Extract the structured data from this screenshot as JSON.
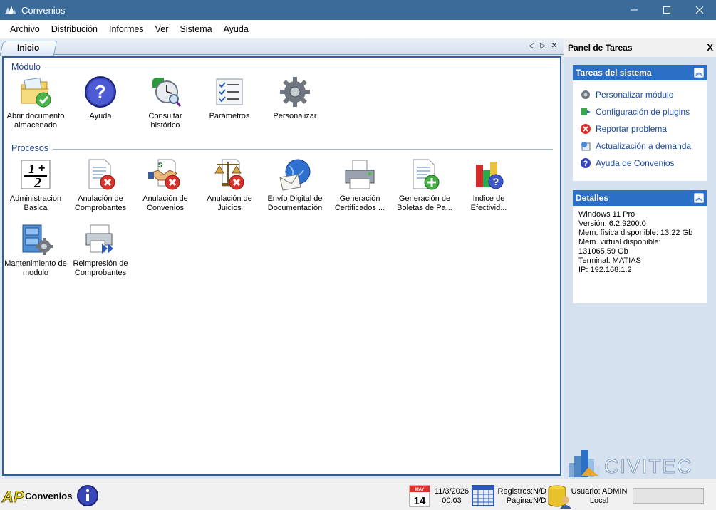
{
  "window": {
    "title": "Convenios"
  },
  "menu": [
    "Archivo",
    "Distribución",
    "Informes",
    "Ver",
    "Sistema",
    "Ayuda"
  ],
  "tab": {
    "label": "Inicio"
  },
  "sections": {
    "modulo": {
      "title": "Módulo",
      "tiles": [
        {
          "label": "Abrir documento\nalmacenado",
          "icon": "folder-check-icon"
        },
        {
          "label": "Ayuda",
          "icon": "help-icon"
        },
        {
          "label": "Consultar\nhistórico",
          "icon": "history-clock-icon"
        },
        {
          "label": "Parámetros",
          "icon": "checklist-icon"
        },
        {
          "label": "Personalizar",
          "icon": "gear-icon"
        }
      ]
    },
    "procesos": {
      "title": "Procesos",
      "tiles": [
        {
          "label": "Administracion\nBasica",
          "icon": "numbers-icon"
        },
        {
          "label": "Anulación de\nComprobantes",
          "icon": "document-cancel-icon"
        },
        {
          "label": "Anulación de\nConvenios",
          "icon": "handshake-cancel-icon"
        },
        {
          "label": "Anulación de\nJuicios",
          "icon": "scales-cancel-icon"
        },
        {
          "label": "Envío Digital de\nDocumentación",
          "icon": "globe-mail-icon"
        },
        {
          "label": "Generación\nCertificados ...",
          "icon": "printer-icon"
        },
        {
          "label": "Generación de\nBoletas de Pa...",
          "icon": "document-add-icon"
        },
        {
          "label": "Indice de\nEfectivid...",
          "icon": "chart-help-icon"
        },
        {
          "label": "Mantenimiento de\nmodulo",
          "icon": "cabinet-gear-icon"
        },
        {
          "label": "Reimpresión de\nComprobantes",
          "icon": "reprint-icon"
        }
      ]
    }
  },
  "taskpanel": {
    "title": "Panel de Tareas",
    "close": "X",
    "system": {
      "title": "Tareas del sistema",
      "items": [
        {
          "label": "Personalizar módulo",
          "icon": "gear-small-icon"
        },
        {
          "label": "Configuración de plugins",
          "icon": "plugin-icon"
        },
        {
          "label": "Reportar problema",
          "icon": "error-icon"
        },
        {
          "label": "Actualización a demanda",
          "icon": "update-icon"
        },
        {
          "label": "Ayuda de Convenios",
          "icon": "help-small-icon"
        }
      ]
    },
    "details": {
      "title": "Detalles",
      "lines": [
        "Windows 11 Pro",
        "Versión: 6.2.9200.0",
        "Mem. física disponible: 13.22 Gb",
        "Mem. virtual disponible:",
        "131065.59 Gb",
        "Terminal: MATIAS",
        "IP: 192.168.1.2"
      ]
    },
    "brand": "CIVITEC"
  },
  "status": {
    "app": "Convenios",
    "logo": "API",
    "cal_month": "MAY",
    "cal_day": "14",
    "date": "11/3/2026",
    "time": "00:03",
    "registros": "Registros:N/D",
    "pagina": "Página:N/D",
    "usuario": "Usuario: ADMIN",
    "ubicacion": "Local"
  },
  "colors": {
    "titlebar": "#3b6b99",
    "accent": "#2c6fc6",
    "link": "#1a4aa3"
  }
}
